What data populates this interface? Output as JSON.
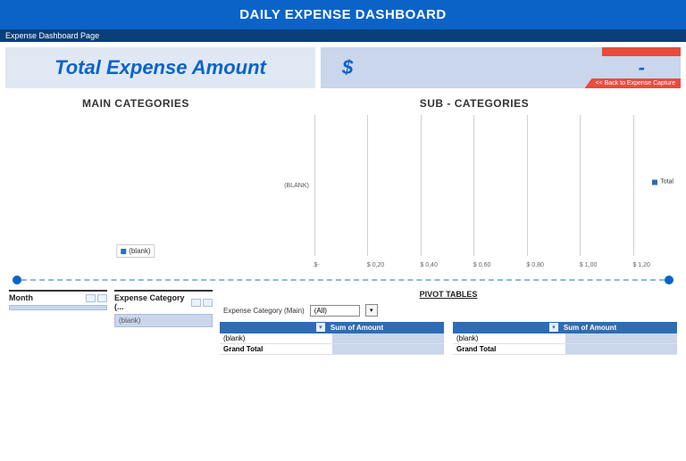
{
  "header": {
    "title": "DAILY EXPENSE DASHBOARD"
  },
  "tab": {
    "label": "Expense Dashboard Page"
  },
  "total": {
    "label": "Total Expense Amount",
    "currency": "$",
    "value": "-",
    "back_link": "<< Back to Expense Capture"
  },
  "charts": {
    "main": {
      "title": "MAIN CATEGORIES",
      "legend": "(blank)"
    },
    "sub": {
      "title": "SUB - CATEGORIES",
      "ylabel": "(BLANK)",
      "ticks": [
        "$-",
        "$ 0,20",
        "$ 0,40",
        "$ 0,60",
        "$ 0,80",
        "$ 1,00",
        "$ 1,20"
      ],
      "legend": "Total"
    }
  },
  "slicers": {
    "month": {
      "label": "Month",
      "item": ""
    },
    "category": {
      "label": "Expense Category (...",
      "item": "(blank)"
    }
  },
  "pivot": {
    "title": "PIVOT TABLES",
    "filter": {
      "label": "Expense Category  (Main)",
      "value": "(All)"
    },
    "tables": [
      {
        "col_left": "",
        "col_right": "Sum of Amount",
        "rows": [
          {
            "label": "(blank)",
            "amount": ""
          },
          {
            "label": "Grand Total",
            "amount": ""
          }
        ]
      },
      {
        "col_left": "",
        "col_right": "Sum of Amount",
        "rows": [
          {
            "label": "(blank)",
            "amount": ""
          },
          {
            "label": "Grand Total",
            "amount": ""
          }
        ]
      }
    ]
  },
  "chart_data": [
    {
      "type": "bar",
      "title": "MAIN CATEGORIES",
      "categories": [
        "(blank)"
      ],
      "values": [
        0
      ],
      "series_name": "(blank)"
    },
    {
      "type": "bar",
      "title": "SUB - CATEGORIES",
      "orientation": "horizontal",
      "categories": [
        "(BLANK)"
      ],
      "series": [
        {
          "name": "Total",
          "values": [
            0
          ]
        }
      ],
      "xlabel": "",
      "ylabel": "",
      "xlim": [
        0,
        1.2
      ],
      "xticks": [
        0,
        0.2,
        0.4,
        0.6,
        0.8,
        1.0,
        1.2
      ]
    }
  ]
}
